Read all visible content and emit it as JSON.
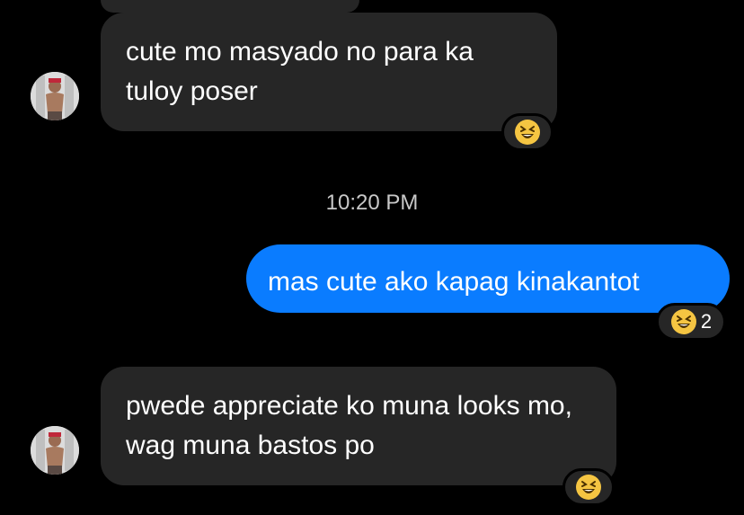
{
  "conversation": {
    "timestamp": "10:20 PM",
    "messages": [
      {
        "sender": "other",
        "text": "cute mo masyado no para ka tuloy poser",
        "reaction": {
          "emoji": "grinning-squinting-face",
          "count": ""
        }
      },
      {
        "sender": "me",
        "text": "mas cute ako kapag kinakantot",
        "reaction": {
          "emoji": "grinning-squinting-face",
          "count": "2"
        }
      },
      {
        "sender": "other",
        "text": "pwede appreciate ko muna looks mo, wag muna bastos po",
        "reaction": {
          "emoji": "grinning-squinting-face",
          "count": ""
        }
      }
    ]
  },
  "colors": {
    "background": "#000000",
    "incoming_bubble": "#262626",
    "outgoing_bubble": "#0a7cff",
    "text": "#ffffff",
    "timestamp": "#c8c8c8"
  }
}
